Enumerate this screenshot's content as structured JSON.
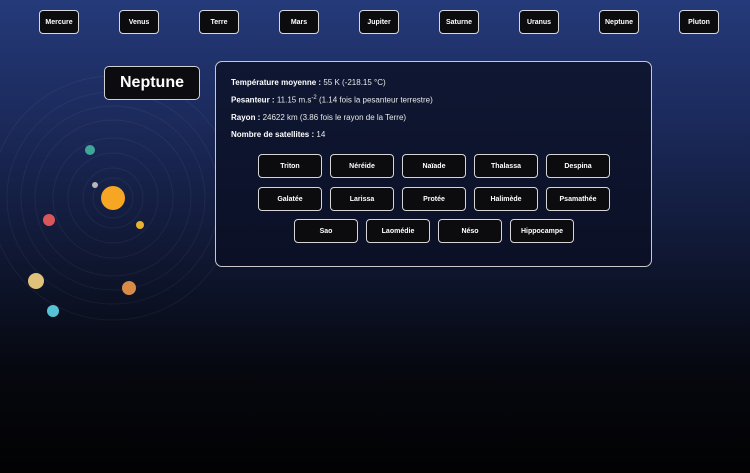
{
  "nav": {
    "planets": [
      "Mercure",
      "Venus",
      "Terre",
      "Mars",
      "Jupiter",
      "Saturne",
      "Uranus",
      "Neptune",
      "Pluton"
    ]
  },
  "planet": {
    "name": "Neptune"
  },
  "info": {
    "temperature_label": "Température moyenne :",
    "temperature_value": "55 K (-218.15 °C)",
    "gravity_label": "Pesanteur :",
    "gravity_value": "11.15 m.s",
    "gravity_exponent": "-2",
    "gravity_note": "(1.14 fois la pesanteur terrestre)",
    "radius_label": "Rayon :",
    "radius_value": "24622 km (3.86 fois le rayon de la Terre)",
    "satellites_label": "Nombre de satellites :",
    "satellites_value": "14"
  },
  "satellites": [
    "Triton",
    "Néréide",
    "Naïade",
    "Thalassa",
    "Despina",
    "Galatée",
    "Larissa",
    "Protée",
    "Halimède",
    "Psamathée",
    "Sao",
    "Laomédie",
    "Néso",
    "Hippocampe"
  ],
  "colors": {
    "sun": "#f6a623",
    "mercury": "#b8b8b8",
    "venus": "#e8b130",
    "earth": "#55c2d6",
    "mars": "#d9565b",
    "jupiter": "#e0c27a",
    "saturn": "#d98a46",
    "uranus": "#3ea79a",
    "neptune": "#2b3fa0"
  }
}
